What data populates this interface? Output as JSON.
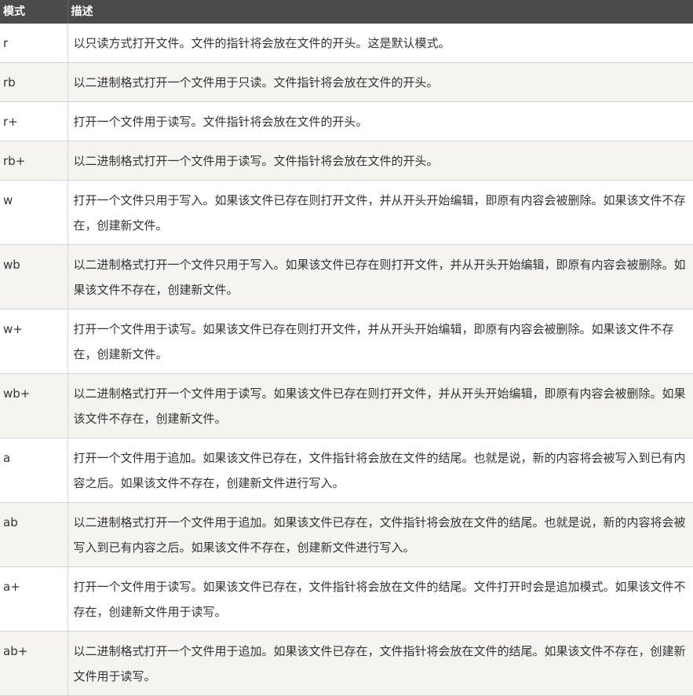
{
  "header": {
    "mode": "模式",
    "description": "描述"
  },
  "rows": [
    {
      "mode": "r",
      "desc": "以只读方式打开文件。文件的指针将会放在文件的开头。这是默认模式。"
    },
    {
      "mode": "rb",
      "desc": "以二进制格式打开一个文件用于只读。文件指针将会放在文件的开头。"
    },
    {
      "mode": "r+",
      "desc": "打开一个文件用于读写。文件指针将会放在文件的开头。"
    },
    {
      "mode": "rb+",
      "desc": "以二进制格式打开一个文件用于读写。文件指针将会放在文件的开头。"
    },
    {
      "mode": "w",
      "desc": "打开一个文件只用于写入。如果该文件已存在则打开文件，并从开头开始编辑，即原有内容会被删除。如果该文件不存在，创建新文件。"
    },
    {
      "mode": "wb",
      "desc": "以二进制格式打开一个文件只用于写入。如果该文件已存在则打开文件，并从开头开始编辑，即原有内容会被删除。如果该文件不存在，创建新文件。"
    },
    {
      "mode": "w+",
      "desc": "打开一个文件用于读写。如果该文件已存在则打开文件，并从开头开始编辑，即原有内容会被删除。如果该文件不存在，创建新文件。"
    },
    {
      "mode": "wb+",
      "desc": "以二进制格式打开一个文件用于读写。如果该文件已存在则打开文件，并从开头开始编辑，即原有内容会被删除。如果该文件不存在，创建新文件。"
    },
    {
      "mode": "a",
      "desc": "打开一个文件用于追加。如果该文件已存在，文件指针将会放在文件的结尾。也就是说，新的内容将会被写入到已有内容之后。如果该文件不存在，创建新文件进行写入。"
    },
    {
      "mode": "ab",
      "desc": "以二进制格式打开一个文件用于追加。如果该文件已存在，文件指针将会放在文件的结尾。也就是说，新的内容将会被写入到已有内容之后。如果该文件不存在，创建新文件进行写入。"
    },
    {
      "mode": "a+",
      "desc": "打开一个文件用于读写。如果该文件已存在，文件指针将会放在文件的结尾。文件打开时会是追加模式。如果该文件不存在，创建新文件用于读写。"
    },
    {
      "mode": "ab+",
      "desc": "以二进制格式打开一个文件用于追加。如果该文件已存在，文件指针将会放在文件的结尾。如果该文件不存在，创建新文件用于读写。"
    }
  ]
}
